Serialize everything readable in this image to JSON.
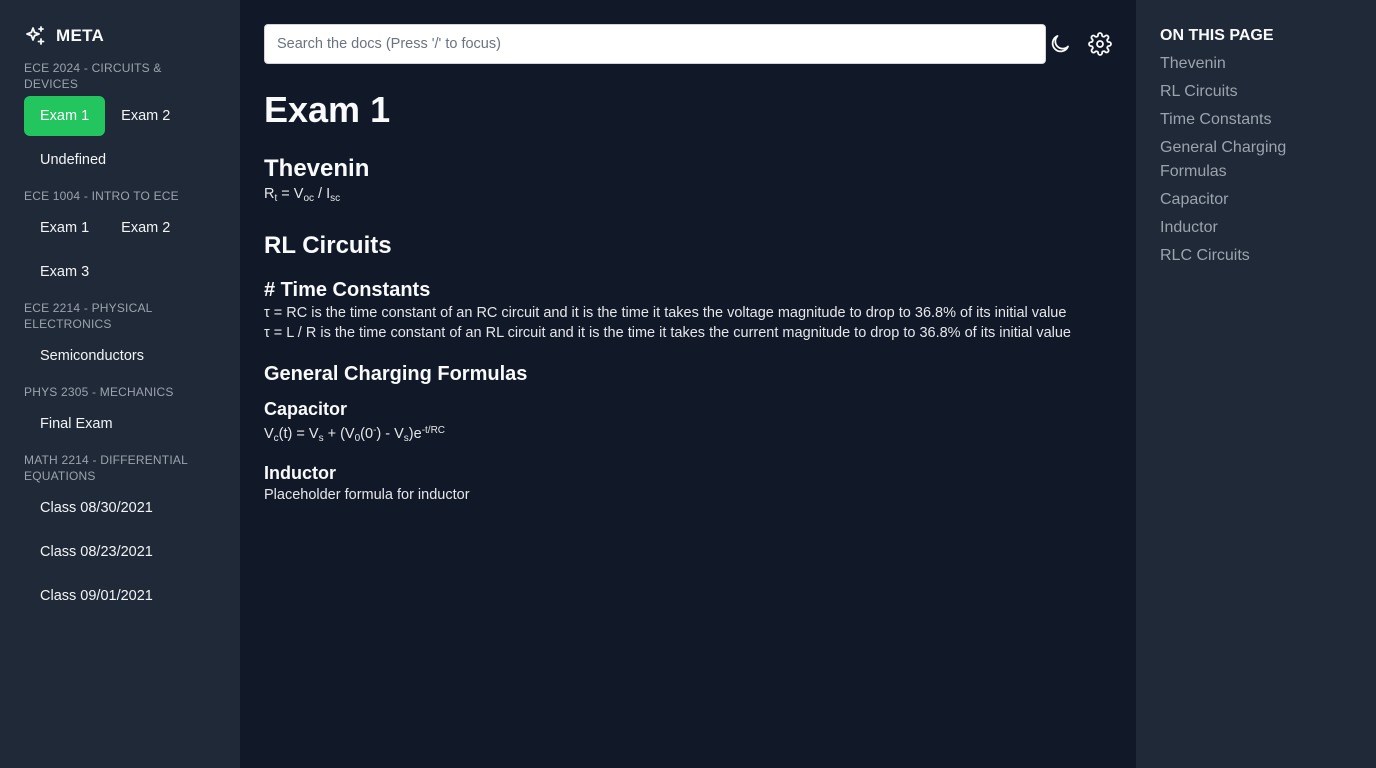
{
  "app": {
    "name": "META",
    "logo_icon": "sparkles-icon",
    "accent": "#22c55e"
  },
  "sidebar": {
    "sections": [
      {
        "title": "ECE 2024 - CIRCUITS & DEVICES",
        "items": [
          {
            "label": "Exam 1",
            "active": true
          },
          {
            "label": "Exam 2"
          },
          {
            "label": "Undefined"
          }
        ]
      },
      {
        "title": "ECE 1004 - INTRO TO ECE",
        "items": [
          {
            "label": "Exam 1"
          },
          {
            "label": "Exam 2"
          },
          {
            "label": "Exam 3"
          }
        ]
      },
      {
        "title": "ECE 2214 - PHYSICAL ELECTRONICS",
        "items": [
          {
            "label": "Semiconductors"
          }
        ]
      },
      {
        "title": "PHYS 2305 - MECHANICS",
        "items": [
          {
            "label": "Final Exam"
          }
        ]
      },
      {
        "title": "MATH 2214 - DIFFERENTIAL EQUATIONS",
        "items": [
          {
            "label": "Class 08/30/2021"
          },
          {
            "label": "Class 08/23/2021"
          },
          {
            "label": "Class 09/01/2021"
          }
        ]
      }
    ]
  },
  "search": {
    "placeholder": "Search the docs (Press '/' to focus)",
    "value": ""
  },
  "toolbar": {
    "theme_icon": "moon-icon",
    "settings_icon": "gear-icon"
  },
  "content": {
    "title": "Exam 1",
    "thevenin": {
      "heading": "Thevenin",
      "formula": {
        "r": "R",
        "r_sub": "t",
        "eq": " = V",
        "voc_sub": "oc",
        "slash": " / I",
        "isc_sub": "sc"
      }
    },
    "rl": {
      "heading": "RL Circuits"
    },
    "time_constants": {
      "heading": "# Time Constants",
      "line1": "τ = RC is the time constant of an RC circuit and it is the time it takes the voltage magnitude to drop to 36.8% of its initial value",
      "line2": "τ = L / R is the time constant of an RL circuit and it is the time it takes the current magnitude to drop to 36.8% of its initial value"
    },
    "charging": {
      "heading": "General Charging Formulas"
    },
    "capacitor": {
      "heading": "Capacitor",
      "formula": {
        "v": "V",
        "c_sub": "c",
        "t_eq": "(t) = V",
        "s_sub": "s",
        "plus": " + (V",
        "zero_sub": "0",
        "paren": "(0",
        "minus_sup": "-",
        "close": ") - V",
        "s_sub2": "s",
        "e": ")e",
        "exp_sup": "-t/RC"
      }
    },
    "inductor": {
      "heading": "Inductor",
      "text": "Placeholder formula for inductor"
    }
  },
  "toc": {
    "title": "ON THIS PAGE",
    "links": [
      "Thevenin",
      "RL Circuits",
      "Time Constants",
      "General Charging Formulas",
      "Capacitor",
      "Inductor",
      "RLC Circuits"
    ]
  }
}
